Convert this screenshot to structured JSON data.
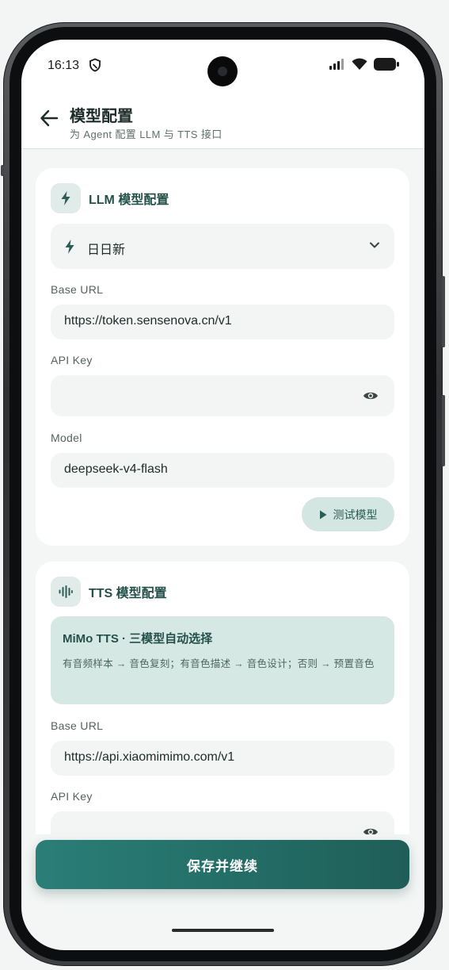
{
  "status_bar": {
    "time": "16:13"
  },
  "header": {
    "title": "模型配置",
    "subtitle": "为 Agent 配置 LLM 与 TTS 接口"
  },
  "llm": {
    "title": "LLM 模型配置",
    "provider": "日日新",
    "base_url_label": "Base URL",
    "base_url_value": "https://token.sensenova.cn/v1",
    "api_key_label": "API Key",
    "api_key_value": "",
    "model_label": "Model",
    "model_value": "deepseek-v4-flash",
    "test_button": "测试模型"
  },
  "tts": {
    "title": "TTS 模型配置",
    "info_title": "MiMo TTS · 三模型自动选择",
    "info_text": "有音频样本 → 音色复刻；有音色描述 → 音色设计；否则 → 预置音色",
    "base_url_label": "Base URL",
    "base_url_value": "https://api.xiaomimimo.com/v1",
    "api_key_label": "API Key",
    "api_key_value": ""
  },
  "save_button": "保存并继续",
  "colors": {
    "accent": "#2a7f78",
    "accent_dark": "#1f5e58",
    "badge_bg": "#e1ecea",
    "info_bg": "#d6e8e4"
  }
}
